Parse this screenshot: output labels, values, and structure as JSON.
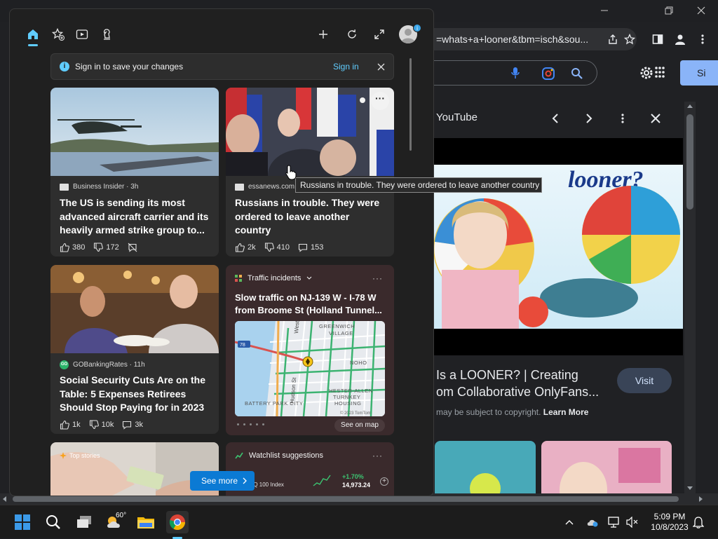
{
  "browser": {
    "address_text": "=whats+a+looner&tbm=isch&sou...",
    "signin_button": "Si",
    "panel": {
      "source": "YouTube",
      "hero_text": "looner?",
      "result_title_line1": "Is a LOONER? | Creating",
      "result_title_line2": "om Collaborative OnlyFans...",
      "visit": "Visit",
      "copyright_text": "may be subject to copyright.",
      "learn_more": "Learn More"
    }
  },
  "widgets": {
    "signin_bar": {
      "info_glyph": "i",
      "text": "Sign in to save your changes",
      "link": "Sign in"
    },
    "avatar_badge": "i",
    "cards": [
      {
        "source": "Business Insider · 3h",
        "title": "The US is sending its most advanced aircraft carrier and its heavily armed strike group to...",
        "likes": "380",
        "dislikes": "172"
      },
      {
        "source": "essanews.com",
        "title": "Russians in trouble. They were ordered to leave another country",
        "likes": "2k",
        "dislikes": "410",
        "comments": "153",
        "more_glyph": "···"
      },
      {
        "source": "GOBankingRates · 11h",
        "source_logo": "GO",
        "title": "Social Security Cuts Are on the Table: 5 Expenses Retirees Should Stop Paying for in 2023",
        "likes": "1k",
        "dislikes": "10k",
        "comments": "3k"
      }
    ],
    "traffic": {
      "header": "Traffic incidents",
      "title": "Slow traffic on NJ-139 W - I-78 W from Broome St (Holland Tunnel...",
      "map_labels": {
        "greenwich": "GREENWICH",
        "village": "VILLAGE",
        "noho": "NOHO",
        "hester": "HESTER-ALLEN",
        "turnkey": "TURNKEY",
        "housing": "HOUSING",
        "battery": "BATTERY PARK CITY",
        "west": "West",
        "hudson": "Hudson St",
        "route": "78",
        "copyright": "© 2023 TomTom"
      },
      "see_on_map": "See on map",
      "dots": "···"
    },
    "top_stories": {
      "label": "Top stories"
    },
    "watchlist": {
      "header": "Watchlist suggestions",
      "index_name": "AQ 100 Index",
      "change": "+1.70%",
      "value": "14,973.24",
      "dots": "···"
    },
    "see_more": "See more",
    "tooltip": "Russians in trouble. They were ordered to leave another country"
  },
  "taskbar": {
    "temperature": "60°",
    "time": "5:09 PM",
    "date": "10/8/2023"
  }
}
